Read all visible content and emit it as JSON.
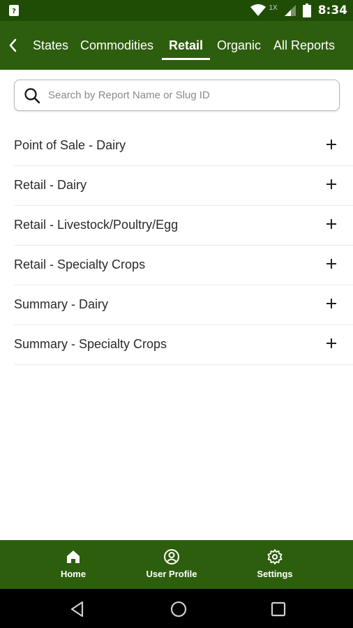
{
  "status_bar": {
    "time": "8:34",
    "network_label": "1X",
    "icons": [
      "notification-icon",
      "wifi-icon",
      "signal-icon",
      "battery-icon"
    ]
  },
  "tabs": {
    "back_icon": "chevron-left-icon",
    "items": [
      {
        "label": "States",
        "active": false
      },
      {
        "label": "Commodities",
        "active": false
      },
      {
        "label": "Retail",
        "active": true
      },
      {
        "label": "Organic",
        "active": false
      },
      {
        "label": "All Reports",
        "active": false
      }
    ]
  },
  "search": {
    "placeholder": "Search by Report Name or Slug ID",
    "value": ""
  },
  "reports": [
    {
      "label": "Point of Sale - Dairy"
    },
    {
      "label": "Retail - Dairy"
    },
    {
      "label": "Retail - Livestock/Poultry/Egg"
    },
    {
      "label": "Retail - Specialty Crops"
    },
    {
      "label": "Summary - Dairy"
    },
    {
      "label": "Summary - Specialty Crops"
    }
  ],
  "bottom_nav": {
    "items": [
      {
        "label": "Home",
        "icon": "home-icon"
      },
      {
        "label": "User Profile",
        "icon": "user-profile-icon"
      },
      {
        "label": "Settings",
        "icon": "gear-icon"
      }
    ]
  },
  "colors": {
    "header_green": "#2d5e0d",
    "status_green": "#1f4d05",
    "text": "#2a2a2a"
  }
}
